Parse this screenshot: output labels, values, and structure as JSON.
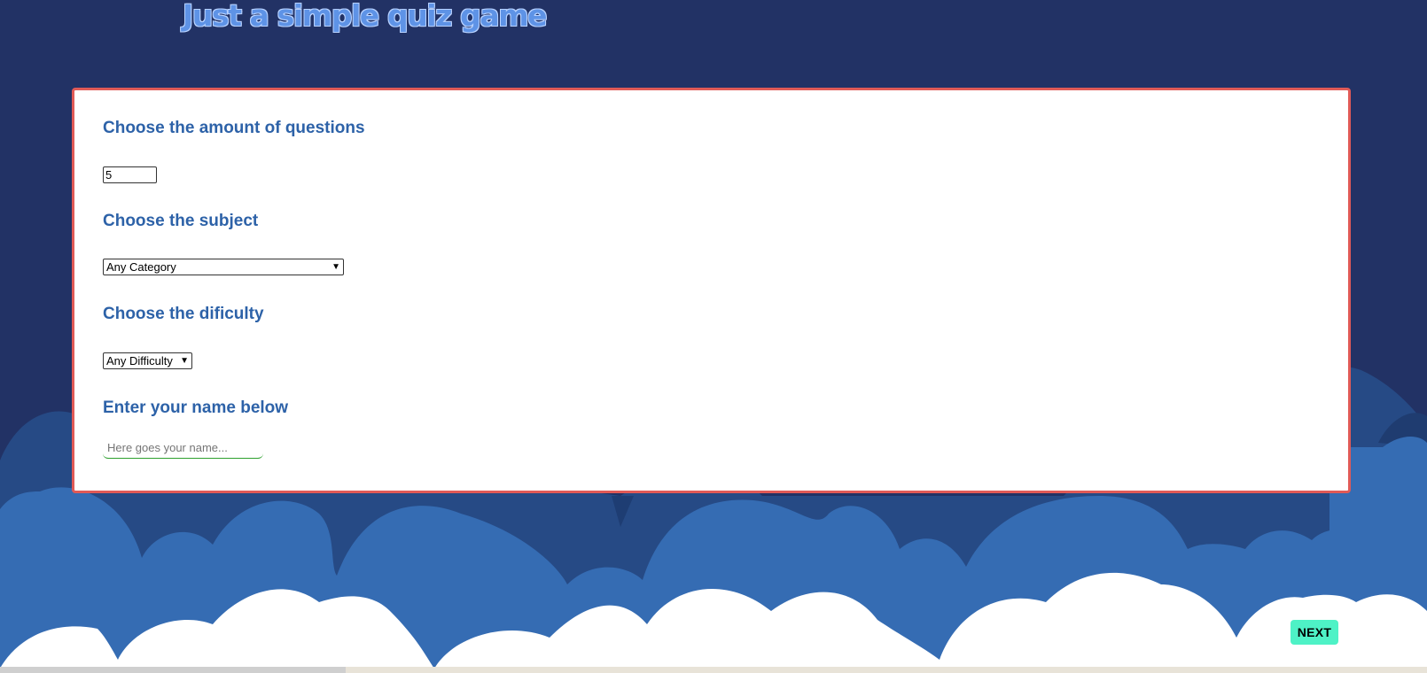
{
  "app": {
    "title": "Just a simple quiz game"
  },
  "form": {
    "amount": {
      "label": "Choose the amount of questions",
      "value": "5"
    },
    "subject": {
      "label": "Choose the subject",
      "selected": "Any Category"
    },
    "difficulty": {
      "label": "Choose the dificulty",
      "selected": "Any Difficulty"
    },
    "name": {
      "label": "Enter your name below",
      "placeholder": "Here goes your name..."
    }
  },
  "actions": {
    "next_label": "NEXT"
  },
  "colors": {
    "background": "#223265",
    "title": "#5e93e6",
    "panel_border": "#e05a57",
    "label": "#2d62a8",
    "next_button": "#4ef2c6",
    "cloud_dark": "#264a85",
    "cloud_mid": "#356cb3",
    "cloud_light": "#ffffff"
  },
  "icons": {
    "select_chevron": "chevron-down-icon"
  }
}
